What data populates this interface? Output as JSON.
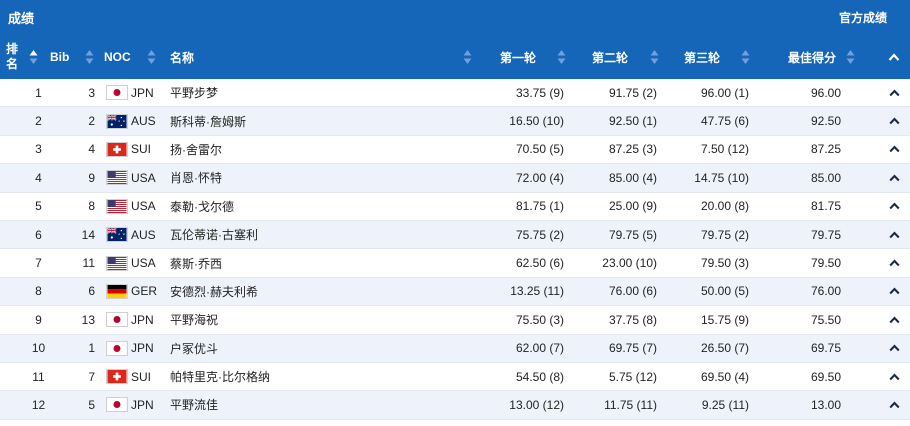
{
  "header": {
    "title": "成绩",
    "official_link": "官方成绩"
  },
  "columns": {
    "rank": "排名",
    "rank_line1": "排",
    "rank_line2": "名",
    "bib": "Bib",
    "noc": "NOC",
    "name": "名称",
    "run1": "第一轮",
    "run2": "第二轮",
    "run3": "第三轮",
    "best": "最佳得分"
  },
  "rows": [
    {
      "rank": "1",
      "bib": "3",
      "noc": "JPN",
      "name": "平野步梦",
      "run1": "33.75 (9)",
      "run2": "91.75 (2)",
      "run3": "96.00 (1)",
      "best": "96.00"
    },
    {
      "rank": "2",
      "bib": "2",
      "noc": "AUS",
      "name": "斯科蒂·詹姆斯",
      "run1": "16.50 (10)",
      "run2": "92.50 (1)",
      "run3": "47.75 (6)",
      "best": "92.50"
    },
    {
      "rank": "3",
      "bib": "4",
      "noc": "SUI",
      "name": "扬·舍雷尔",
      "run1": "70.50 (5)",
      "run2": "87.25 (3)",
      "run3": "7.50 (12)",
      "best": "87.25"
    },
    {
      "rank": "4",
      "bib": "9",
      "noc": "USA",
      "name": "肖恩·怀特",
      "run1": "72.00 (4)",
      "run2": "85.00 (4)",
      "run3": "14.75 (10)",
      "best": "85.00"
    },
    {
      "rank": "5",
      "bib": "8",
      "noc": "USA",
      "name": "泰勒·戈尔德",
      "run1": "81.75 (1)",
      "run2": "25.00 (9)",
      "run3": "20.00 (8)",
      "best": "81.75"
    },
    {
      "rank": "6",
      "bib": "14",
      "noc": "AUS",
      "name": "瓦伦蒂诺·古塞利",
      "run1": "75.75 (2)",
      "run2": "79.75 (5)",
      "run3": "79.75 (2)",
      "best": "79.75"
    },
    {
      "rank": "7",
      "bib": "11",
      "noc": "USA",
      "name": "蔡斯·乔西",
      "run1": "62.50 (6)",
      "run2": "23.00 (10)",
      "run3": "79.50 (3)",
      "best": "79.50"
    },
    {
      "rank": "8",
      "bib": "6",
      "noc": "GER",
      "name": "安德烈·赫夫利希",
      "run1": "13.25 (11)",
      "run2": "76.00 (6)",
      "run3": "50.00 (5)",
      "best": "76.00"
    },
    {
      "rank": "9",
      "bib": "13",
      "noc": "JPN",
      "name": "平野海祝",
      "run1": "75.50 (3)",
      "run2": "37.75 (8)",
      "run3": "15.75 (9)",
      "best": "75.50"
    },
    {
      "rank": "10",
      "bib": "1",
      "noc": "JPN",
      "name": "户冢优斗",
      "run1": "62.00 (7)",
      "run2": "69.75 (7)",
      "run3": "26.50 (7)",
      "best": "69.75"
    },
    {
      "rank": "11",
      "bib": "7",
      "noc": "SUI",
      "name": "帕特里克·比尔格纳",
      "run1": "54.50 (8)",
      "run2": "5.75 (12)",
      "run3": "69.50 (4)",
      "best": "69.50"
    },
    {
      "rank": "12",
      "bib": "5",
      "noc": "JPN",
      "name": "平野流佳",
      "run1": "13.00 (12)",
      "run2": "11.75 (11)",
      "run3": "9.25 (11)",
      "best": "13.00"
    }
  ],
  "colors": {
    "header_bg": "#1565b8",
    "row_alt_bg": "#eef3fb",
    "text": "#222222"
  }
}
